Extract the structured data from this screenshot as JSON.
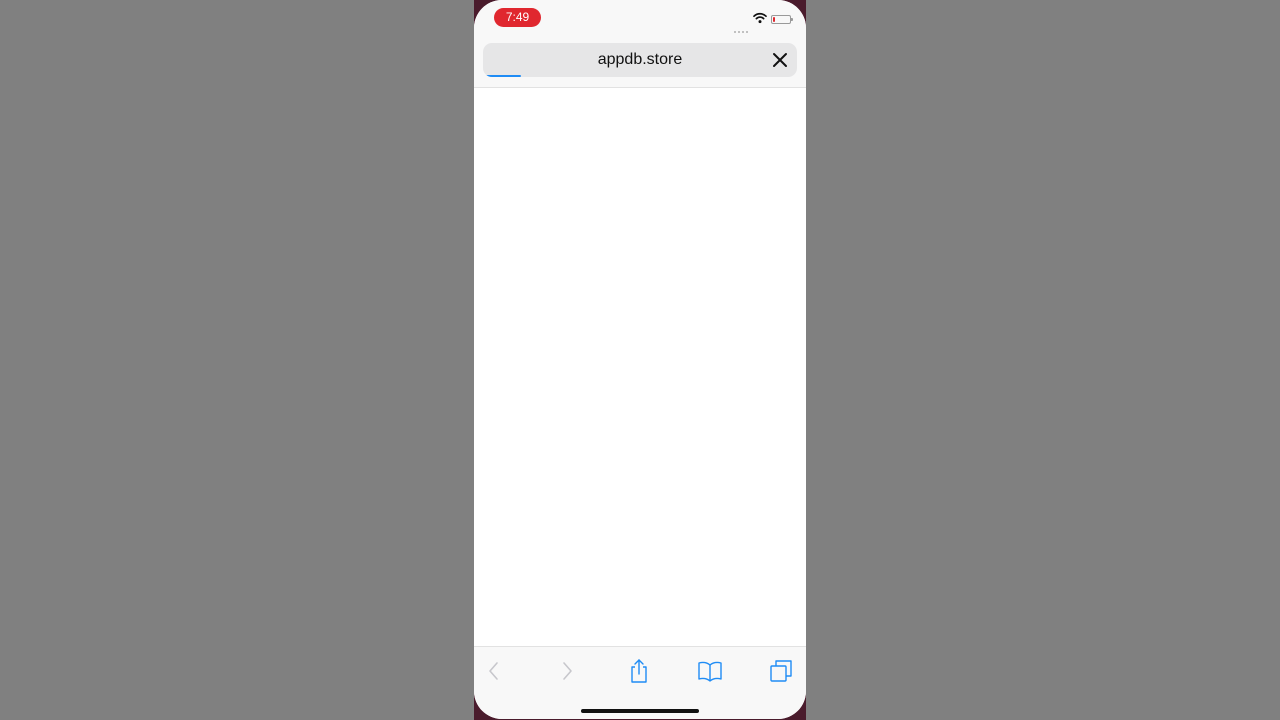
{
  "status_bar": {
    "time": "7:49",
    "time_pill_color": "#e0272f",
    "signal_icon": "cellular-dots-icon",
    "wifi_icon": "wifi-icon",
    "battery_icon": "battery-icon",
    "battery_level": 0.15
  },
  "address_bar": {
    "url": "appdb.store",
    "close_icon": "close-icon",
    "loading_progress": 0.11,
    "progress_color": "#1f8cf5"
  },
  "toolbar": {
    "back_icon": "chevron-left-icon",
    "forward_icon": "chevron-right-icon",
    "share_icon": "share-icon",
    "bookmarks_icon": "book-icon",
    "tabs_icon": "tabs-icon",
    "accent_color": "#1f8cf5",
    "disabled_color": "#c7c7cc"
  }
}
